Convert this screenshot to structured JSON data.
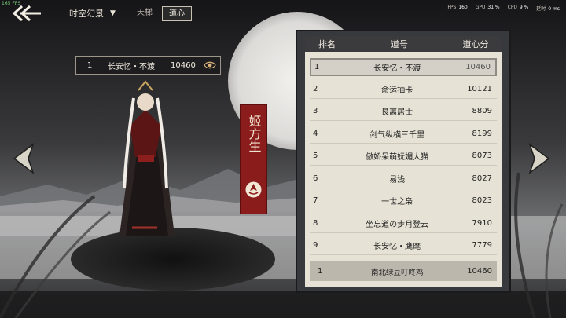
{
  "debug": {
    "fps_counter": "165 FPS"
  },
  "header": {
    "mode_label": "时空幻景",
    "tabs": [
      {
        "label": "天梯",
        "active": false
      },
      {
        "label": "道心",
        "active": true
      }
    ],
    "stats": [
      {
        "label": "FPS",
        "value": "160"
      },
      {
        "label": "GPU",
        "value": "31 %"
      },
      {
        "label": "CPU",
        "value": "9 %"
      },
      {
        "label": "延时",
        "value": "0 ms"
      }
    ]
  },
  "player": {
    "rank": "1",
    "name": "长安忆・不渡",
    "score": "10460",
    "icon": "eye-icon"
  },
  "character": {
    "name": "姬方生",
    "emblem_icon": "sect-emblem-icon"
  },
  "leaderboard": {
    "headers": {
      "rank": "排名",
      "name": "道号",
      "score": "道心分"
    },
    "rows": [
      {
        "rank": "1",
        "name": "长安忆・不渡",
        "score": "10460"
      },
      {
        "rank": "2",
        "name": "命运抽卡",
        "score": "10121"
      },
      {
        "rank": "3",
        "name": "艮离居士",
        "score": "8809"
      },
      {
        "rank": "4",
        "name": "剑气纵横三千里",
        "score": "8199"
      },
      {
        "rank": "5",
        "name": "傲娇呆萌妩媚大猫",
        "score": "8073"
      },
      {
        "rank": "6",
        "name": "易浅",
        "score": "8027"
      },
      {
        "rank": "7",
        "name": "一世之枭",
        "score": "8023"
      },
      {
        "rank": "8",
        "name": "坐忘道の步月登云",
        "score": "7910"
      },
      {
        "rank": "9",
        "name": "长安忆・鹰麾",
        "score": "7779"
      }
    ],
    "self": {
      "rank": "1",
      "name": "南北绿豆叮咚鸡",
      "score": "10460"
    }
  },
  "colors": {
    "banner": "#8b1c1c",
    "panel": "#e7e2d6",
    "header": "#3b3b3e"
  }
}
